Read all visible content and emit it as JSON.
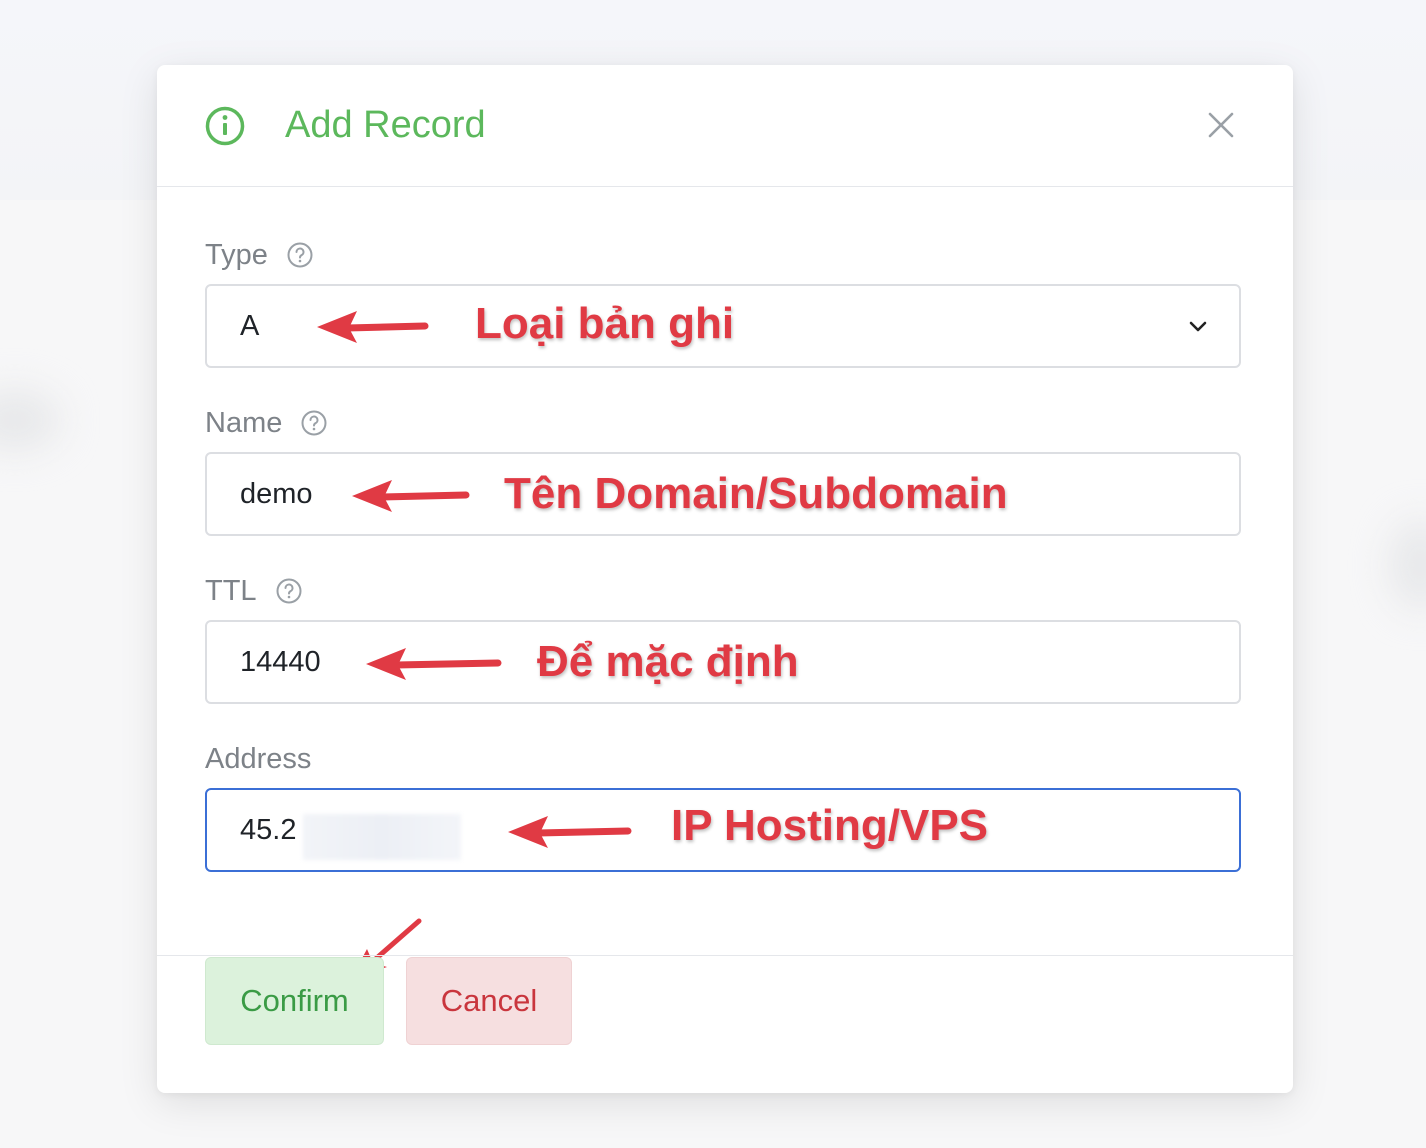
{
  "dialog": {
    "title": "Add Record"
  },
  "form": {
    "type": {
      "label": "Type",
      "value": "A"
    },
    "name": {
      "label": "Name",
      "value": "demo"
    },
    "ttl": {
      "label": "TTL",
      "value": "14440"
    },
    "address": {
      "label": "Address",
      "value": "45.2"
    }
  },
  "annotations": {
    "type_note": "Loại bản ghi",
    "name_note": "Tên Domain/Subdomain",
    "ttl_note": "Để mặc định",
    "address_note": "IP Hosting/VPS"
  },
  "buttons": {
    "confirm": "Confirm",
    "cancel": "Cancel"
  },
  "colors": {
    "title_green": "#5cb85c",
    "annotation_red": "#e03a44",
    "focus_blue": "#3b6fd6",
    "confirm_bg": "#dcf2dc",
    "cancel_bg": "#f6dfe0"
  },
  "icons": {
    "header": "info-icon",
    "close": "close-icon",
    "help": "help-icon",
    "select": "chevron-down-icon"
  }
}
